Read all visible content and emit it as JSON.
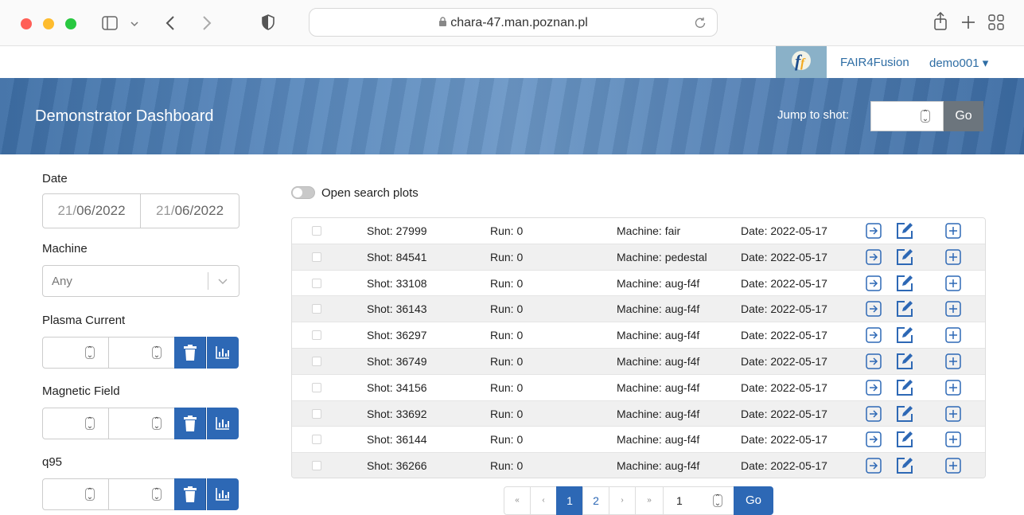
{
  "browser": {
    "url": "chara-47.man.poznan.pl"
  },
  "topnav": {
    "brand": "FAIR4Fusion",
    "user": "demo001 ▾"
  },
  "banner": {
    "title": "Demonstrator Dashboard",
    "jump_label": "Jump to shot:",
    "go_label": "Go"
  },
  "sidebar": {
    "date_label": "Date",
    "date_from": "21/06/2022",
    "date_to": "21/06/2022",
    "machine_label": "Machine",
    "machine_value": "Any",
    "plasma_label": "Plasma Current",
    "field_label": "Magnetic Field",
    "q95_label": "q95"
  },
  "toggle": {
    "label": "Open search plots",
    "checked": false
  },
  "table": {
    "rows": [
      {
        "shot": "Shot: 27999",
        "run": "Run: 0",
        "machine": "Machine: fair",
        "date": "Date: 2022-05-17"
      },
      {
        "shot": "Shot: 84541",
        "run": "Run: 0",
        "machine": "Machine: pedestal",
        "date": "Date: 2022-05-17"
      },
      {
        "shot": "Shot: 33108",
        "run": "Run: 0",
        "machine": "Machine: aug-f4f",
        "date": "Date: 2022-05-17"
      },
      {
        "shot": "Shot: 36143",
        "run": "Run: 0",
        "machine": "Machine: aug-f4f",
        "date": "Date: 2022-05-17"
      },
      {
        "shot": "Shot: 36297",
        "run": "Run: 0",
        "machine": "Machine: aug-f4f",
        "date": "Date: 2022-05-17"
      },
      {
        "shot": "Shot: 36749",
        "run": "Run: 0",
        "machine": "Machine: aug-f4f",
        "date": "Date: 2022-05-17"
      },
      {
        "shot": "Shot: 34156",
        "run": "Run: 0",
        "machine": "Machine: aug-f4f",
        "date": "Date: 2022-05-17"
      },
      {
        "shot": "Shot: 33692",
        "run": "Run: 0",
        "machine": "Machine: aug-f4f",
        "date": "Date: 2022-05-17"
      },
      {
        "shot": "Shot: 36144",
        "run": "Run: 0",
        "machine": "Machine: aug-f4f",
        "date": "Date: 2022-05-17"
      },
      {
        "shot": "Shot: 36266",
        "run": "Run: 0",
        "machine": "Machine: aug-f4f",
        "date": "Date: 2022-05-17"
      }
    ]
  },
  "pagination": {
    "first": "«",
    "prev": "‹",
    "pages": [
      "1",
      "2"
    ],
    "current": "1",
    "next": "›",
    "last": "»",
    "page_input": "1",
    "go_label": "Go"
  }
}
